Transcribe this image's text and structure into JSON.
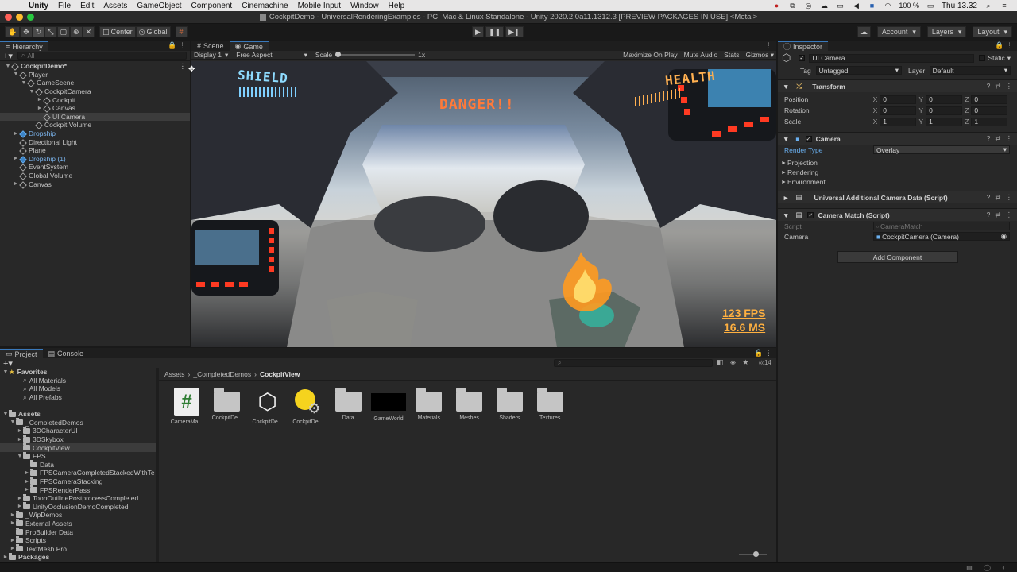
{
  "menubar": {
    "app": "Unity",
    "items": [
      "File",
      "Edit",
      "Assets",
      "GameObject",
      "Component",
      "Cinemachine",
      "Mobile Input",
      "Window",
      "Help"
    ],
    "battery": "100 %",
    "clock": "Thu 13.32"
  },
  "window_title": "CockpitDemo - UniversalRenderingExamples - PC, Mac & Linux Standalone - Unity 2020.2.0a11.1312.3 [PREVIEW PACKAGES IN USE] <Metal>",
  "toolbar": {
    "pivot": "Center",
    "space": "Global",
    "account": "Account",
    "layers": "Layers",
    "layout": "Layout"
  },
  "hierarchy": {
    "tab": "Hierarchy",
    "search_placeholder": "All",
    "rows": [
      {
        "label": "CockpitDemo*",
        "indent": 0,
        "arrow": "▼",
        "icon": "unity",
        "bold": true
      },
      {
        "label": "Player",
        "indent": 1,
        "arrow": "▼",
        "icon": "cube"
      },
      {
        "label": "GameScene",
        "indent": 2,
        "arrow": "▼",
        "icon": "cube"
      },
      {
        "label": "CockpitCamera",
        "indent": 3,
        "arrow": "▼",
        "icon": "cube"
      },
      {
        "label": "Cockpit",
        "indent": 4,
        "arrow": "►",
        "icon": "cube"
      },
      {
        "label": "Canvas",
        "indent": 4,
        "arrow": "►",
        "icon": "cube"
      },
      {
        "label": "UI Camera",
        "indent": 4,
        "arrow": "",
        "icon": "cube",
        "state": "hl"
      },
      {
        "label": "Cockpit Volume",
        "indent": 3,
        "arrow": "",
        "icon": "cube"
      },
      {
        "label": "Dropship",
        "indent": 1,
        "arrow": "►",
        "icon": "blue"
      },
      {
        "label": "Directional Light",
        "indent": 1,
        "arrow": "",
        "icon": "cube"
      },
      {
        "label": "Plane",
        "indent": 1,
        "arrow": "",
        "icon": "cube"
      },
      {
        "label": "Dropship (1)",
        "indent": 1,
        "arrow": "►",
        "icon": "blue"
      },
      {
        "label": "EventSystem",
        "indent": 1,
        "arrow": "",
        "icon": "cube"
      },
      {
        "label": "Global Volume",
        "indent": 1,
        "arrow": "",
        "icon": "cube"
      },
      {
        "label": "Canvas",
        "indent": 1,
        "arrow": "►",
        "icon": "cube"
      }
    ]
  },
  "scene_tabs": {
    "scene": "Scene",
    "game": "Game"
  },
  "game_bar": {
    "display": "Display 1",
    "aspect": "Free Aspect",
    "scale_label": "Scale",
    "scale_value": "1x",
    "maximize": "Maximize On Play",
    "mute": "Mute Audio",
    "stats": "Stats",
    "gizmos": "Gizmos"
  },
  "game_view": {
    "shield": "SHIELD",
    "health": "HEALTH",
    "danger": "DANGER!!",
    "fps": "123 FPS",
    "ms": "16.6 MS",
    "shield_level": 1.0,
    "health_level": 1.0
  },
  "inspector": {
    "tab": "Inspector",
    "object_name": "UI Camera",
    "static": "Static",
    "tag_label": "Tag",
    "tag": "Untagged",
    "layer_label": "Layer",
    "layer": "Default",
    "transform": {
      "title": "Transform",
      "rows": [
        {
          "label": "Position",
          "x": "0",
          "y": "0",
          "z": "0"
        },
        {
          "label": "Rotation",
          "x": "0",
          "y": "0",
          "z": "0"
        },
        {
          "label": "Scale",
          "x": "1",
          "y": "1",
          "z": "1"
        }
      ]
    },
    "camera": {
      "title": "Camera",
      "render_type_label": "Render Type",
      "render_type": "Overlay",
      "sections": [
        "Projection",
        "Rendering",
        "Environment"
      ]
    },
    "uacd": {
      "title": "Universal Additional Camera Data (Script)"
    },
    "camera_match": {
      "title": "Camera Match (Script)",
      "script_label": "Script",
      "script_value": "CameraMatch",
      "camera_label": "Camera",
      "camera_value": "CockpitCamera (Camera)"
    },
    "add_component": "Add Component"
  },
  "project": {
    "tab_project": "Project",
    "tab_console": "Console",
    "breadcrumb": [
      "Assets",
      "_CompletedDemos",
      "CockpitView"
    ],
    "badge_count": "14",
    "tree": [
      {
        "label": "Favorites",
        "indent": 0,
        "arrow": "▼",
        "type": "star",
        "bold": true
      },
      {
        "label": "All Materials",
        "indent": 2,
        "arrow": "",
        "type": "search"
      },
      {
        "label": "All Models",
        "indent": 2,
        "arrow": "",
        "type": "search"
      },
      {
        "label": "All Prefabs",
        "indent": 2,
        "arrow": "",
        "type": "search"
      },
      {
        "label": "",
        "indent": 0,
        "arrow": "",
        "type": "gap"
      },
      {
        "label": "Assets",
        "indent": 0,
        "arrow": "▼",
        "type": "folder",
        "bold": true
      },
      {
        "label": "_CompletedDemos",
        "indent": 1,
        "arrow": "▼",
        "type": "folder"
      },
      {
        "label": "3DCharacterUI",
        "indent": 2,
        "arrow": "►",
        "type": "folder"
      },
      {
        "label": "3DSkybox",
        "indent": 2,
        "arrow": "►",
        "type": "folder"
      },
      {
        "label": "CockpitView",
        "indent": 2,
        "arrow": "",
        "type": "folder",
        "state": "hl"
      },
      {
        "label": "FPS",
        "indent": 2,
        "arrow": "▼",
        "type": "folder"
      },
      {
        "label": "Data",
        "indent": 3,
        "arrow": "",
        "type": "folder"
      },
      {
        "label": "FPSCameraCompletedStackedWithTe",
        "indent": 3,
        "arrow": "►",
        "type": "folder"
      },
      {
        "label": "FPSCameraStacking",
        "indent": 3,
        "arrow": "►",
        "type": "folder"
      },
      {
        "label": "FPSRenderPass",
        "indent": 3,
        "arrow": "►",
        "type": "folder"
      },
      {
        "label": "ToonOutlinePostprocessCompleted",
        "indent": 2,
        "arrow": "►",
        "type": "folder"
      },
      {
        "label": "UnityOcclusionDemoCompleted",
        "indent": 2,
        "arrow": "►",
        "type": "folder"
      },
      {
        "label": "_WipDemos",
        "indent": 1,
        "arrow": "►",
        "type": "folder"
      },
      {
        "label": "External Assets",
        "indent": 1,
        "arrow": "►",
        "type": "folder"
      },
      {
        "label": "ProBuilder Data",
        "indent": 1,
        "arrow": "",
        "type": "folder"
      },
      {
        "label": "Scripts",
        "indent": 1,
        "arrow": "►",
        "type": "folder"
      },
      {
        "label": "TextMesh Pro",
        "indent": 1,
        "arrow": "►",
        "type": "folder"
      },
      {
        "label": "Packages",
        "indent": 0,
        "arrow": "►",
        "type": "folder",
        "bold": true
      }
    ],
    "assets": [
      {
        "label": "CameraMa...",
        "kind": "script"
      },
      {
        "label": "CockpitDe...",
        "kind": "folder"
      },
      {
        "label": "CockpitDe...",
        "kind": "unity"
      },
      {
        "label": "CockpitDe...",
        "kind": "light"
      },
      {
        "label": "Data",
        "kind": "folder"
      },
      {
        "label": "GameWorld",
        "kind": "black"
      },
      {
        "label": "Materials",
        "kind": "folder"
      },
      {
        "label": "Meshes",
        "kind": "folder"
      },
      {
        "label": "Shaders",
        "kind": "folder"
      },
      {
        "label": "Textures",
        "kind": "folder"
      }
    ]
  }
}
